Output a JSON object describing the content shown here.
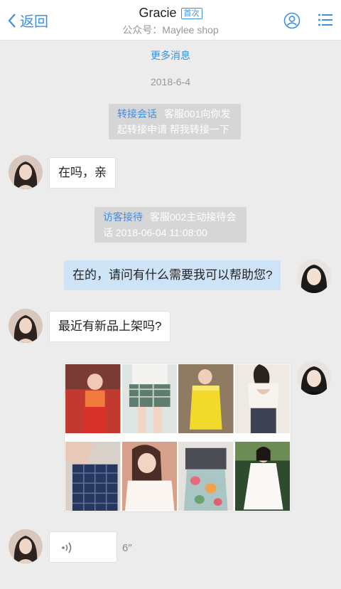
{
  "header": {
    "back_label": "返回",
    "title": "Gracie",
    "badge": "首次",
    "subtitle": "公众号：Maylee shop"
  },
  "messages": {
    "more_label": "更多消息",
    "date": "2018-6-4",
    "sys1": {
      "tag": "转接会话",
      "line1": "客服001向你发",
      "line2": "起转接申请  帮我转接一下"
    },
    "msg1": "在吗，亲",
    "sys2": {
      "tag": "访客接待",
      "line1": "客服002主动接待会",
      "line2": "话  2018-06-04 11:08:00"
    },
    "msg2": "在的，请问有什么需要我可以帮助您?",
    "msg3": "最近有新品上架吗?",
    "voice_duration": "6″"
  },
  "colors": {
    "accent": "#3d8fe0",
    "bubble_self": "#cfe3f7",
    "background": "#ececec"
  }
}
